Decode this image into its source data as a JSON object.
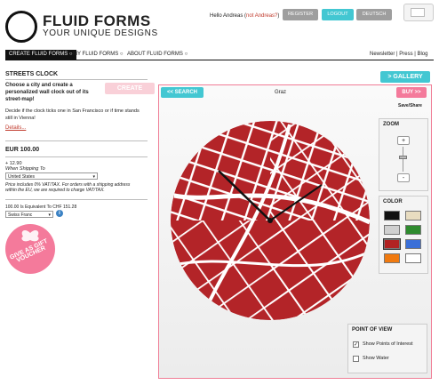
{
  "brand": {
    "title": "FLUID FORMS",
    "subtitle": "YOUR UNIQUE DESIGNS"
  },
  "header": {
    "greeting": "Hello Andreas (",
    "not_user_link": "not Andreas?",
    "greeting_end": ")",
    "register": "REGISTER",
    "logout": "LOGOUT",
    "language": "DEUTSCH"
  },
  "nav": {
    "create": "CREATE FLUID FORMS",
    "my": "MY FLUID FORMS",
    "about": "ABOUT FLUID FORMS",
    "right_links": "Newsletter | Press | Blog"
  },
  "product": {
    "title": "STREETS CLOCK",
    "intro": "Choose a city and create a personalized wall clock out of its street-map!",
    "description": "Decide if the clock ticks one in San Francisco or if time stands still in Vienna!",
    "details_link": "Details...",
    "create_button": "CREATE"
  },
  "pricing": {
    "price": "EUR 100.00",
    "shipping_amount": "+ 12.90",
    "shipping_when": "When Shipping To",
    "country": "United States",
    "vat_note": "Price includes 0% VAT/TAX. For orders with a shipping address within the EU, we are required to charge VAT/TAX.",
    "equivalent": "100.00 Is Equivalent To CHF 151.28",
    "currency": "Swiss Franc"
  },
  "voucher": {
    "label": "GIVE AS GIFT VOUCHER"
  },
  "editor": {
    "gallery_button": "> GALLERY",
    "search_button": "<< SEARCH",
    "city": "Graz",
    "buy_button": "BUY >>",
    "save_share": "Save/Share",
    "zoom": {
      "title": "ZOOM",
      "plus": "+",
      "minus": "-",
      "level": 0.6
    },
    "color": {
      "title": "COLOR",
      "swatches": [
        "#111111",
        "#e8dcc0",
        "#d0d0d0",
        "#2e8b2e",
        "#b22222",
        "#3a6fd8",
        "#f07a10",
        "#ffffff"
      ],
      "selected": "#b22222"
    },
    "point_of_view": {
      "title": "POINT OF VIEW",
      "options": [
        {
          "label": "Show Points of Interest",
          "checked": true
        },
        {
          "label": "Show Water",
          "checked": false
        }
      ]
    },
    "clock_color": "#b32428"
  }
}
